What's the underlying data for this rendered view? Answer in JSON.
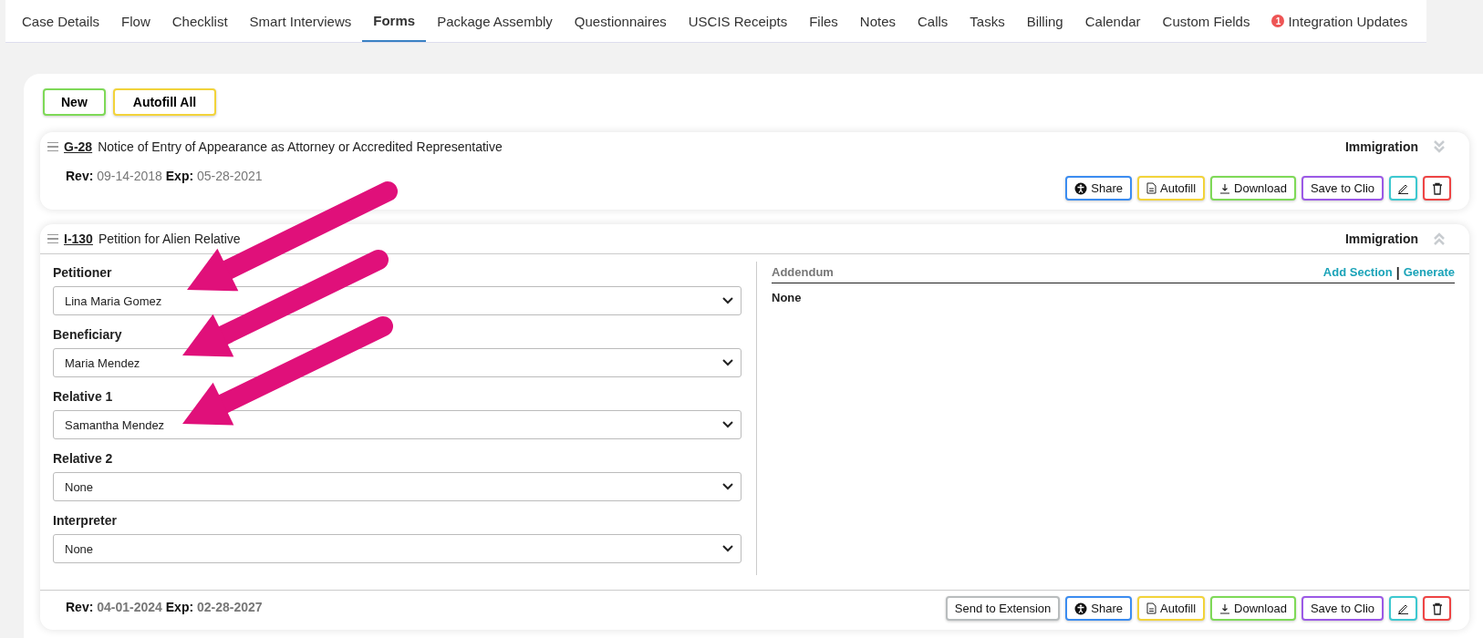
{
  "tabs": [
    {
      "label": "Case Details",
      "selected": false
    },
    {
      "label": "Flow",
      "selected": false
    },
    {
      "label": "Checklist",
      "selected": false
    },
    {
      "label": "Smart Interviews",
      "selected": false
    },
    {
      "label": "Forms",
      "selected": true
    },
    {
      "label": "Package Assembly",
      "selected": false
    },
    {
      "label": "Questionnaires",
      "selected": false
    },
    {
      "label": "USCIS Receipts",
      "selected": false
    },
    {
      "label": "Files",
      "selected": false
    },
    {
      "label": "Notes",
      "selected": false
    },
    {
      "label": "Calls",
      "selected": false
    },
    {
      "label": "Tasks",
      "selected": false
    },
    {
      "label": "Billing",
      "selected": false
    },
    {
      "label": "Calendar",
      "selected": false
    },
    {
      "label": "Custom Fields",
      "selected": false
    },
    {
      "label": "Integration Updates",
      "selected": false,
      "badge": "1"
    }
  ],
  "toolbar": [
    {
      "label": "New",
      "kind": "new"
    },
    {
      "label": "Autofill All",
      "kind": "autofill"
    }
  ],
  "forms": [
    {
      "code": "G-28",
      "title": "Notice of Entry of Appearance as Attorney or Accredited Representative",
      "category": "Immigration",
      "expanded": false,
      "rev_label": "Rev:",
      "rev": "09-14-2018",
      "exp_label": "Exp:",
      "exp": "05-28-2021",
      "buttons": [
        {
          "kind": "share",
          "label": "Share"
        },
        {
          "kind": "autofill",
          "label": "Autofill"
        },
        {
          "kind": "download",
          "label": "Download"
        },
        {
          "kind": "clio",
          "label": "Save to Clio"
        },
        {
          "kind": "edit"
        },
        {
          "kind": "delete"
        }
      ]
    },
    {
      "code": "I-130",
      "title": "Petition for Alien Relative",
      "category": "Immigration",
      "expanded": true,
      "rev_label": "Rev:",
      "rev": "04-01-2024",
      "exp_label": "Exp:",
      "exp": "02-28-2027",
      "fields": [
        {
          "label": "Petitioner",
          "value": "Lina Maria Gomez"
        },
        {
          "label": "Beneficiary",
          "value": "Maria Mendez"
        },
        {
          "label": "Relative 1",
          "value": "Samantha Mendez"
        },
        {
          "label": "Relative 2",
          "value": "None"
        },
        {
          "label": "Interpreter",
          "value": "None"
        }
      ],
      "addendum": {
        "title": "Addendum",
        "add_link": "Add Section",
        "separator": "|",
        "generate_link": "Generate",
        "content": "None"
      },
      "buttons": [
        {
          "kind": "extension",
          "label": "Send to Extension"
        },
        {
          "kind": "share",
          "label": "Share"
        },
        {
          "kind": "autofill",
          "label": "Autofill"
        },
        {
          "kind": "download",
          "label": "Download"
        },
        {
          "kind": "clio",
          "label": "Save to Clio"
        },
        {
          "kind": "edit"
        },
        {
          "kind": "delete"
        }
      ]
    }
  ]
}
